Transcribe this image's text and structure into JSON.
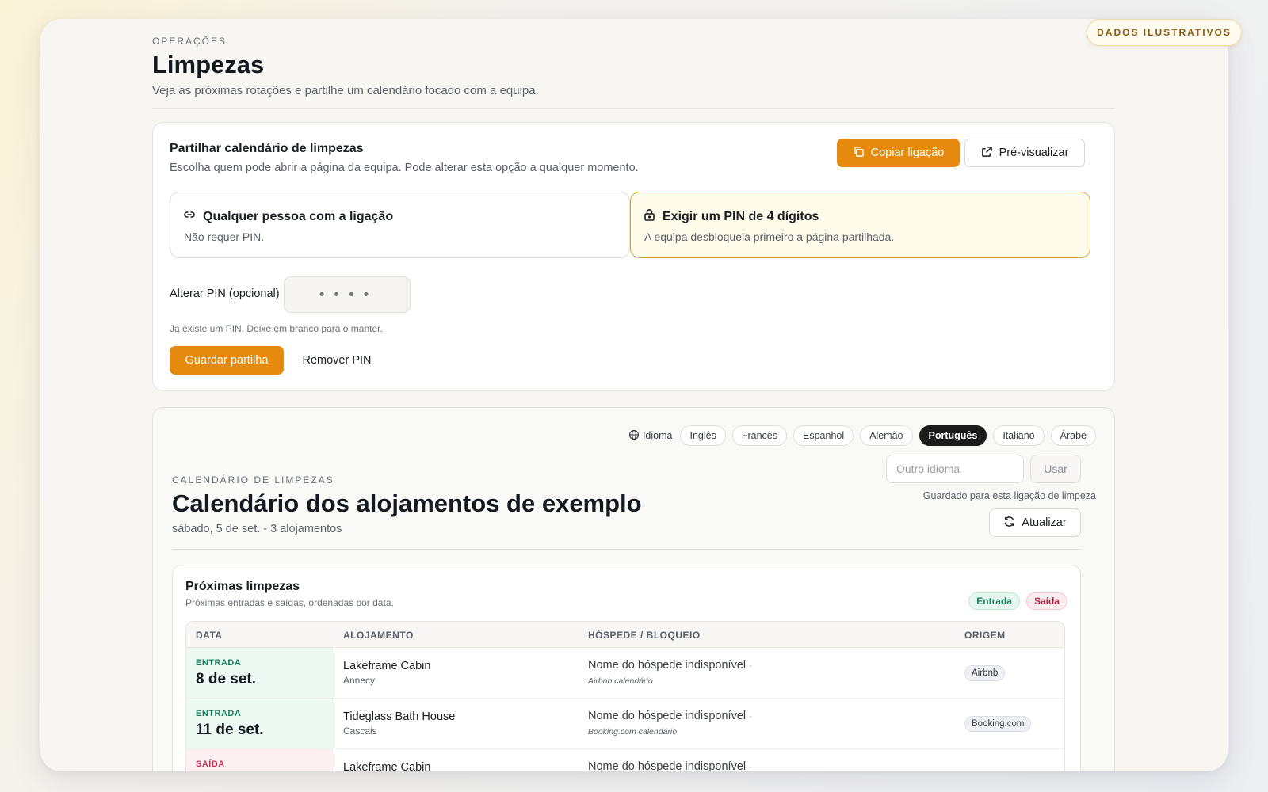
{
  "badge": "DADOS ILUSTRATIVOS",
  "header": {
    "eyebrow": "OPERAÇÕES",
    "title": "Limpezas",
    "subtitle": "Veja as próximas rotações e partilhe um calendário focado com a equipa."
  },
  "share": {
    "title": "Partilhar calendário de limpezas",
    "description": "Escolha quem pode abrir a página da equipa. Pode alterar esta opção a qualquer momento.",
    "copy_label": "Copiar ligação",
    "preview_label": "Pré-visualizar",
    "options": [
      {
        "title": "Qualquer pessoa com a ligação",
        "desc": "Não requer PIN.",
        "icon": "link-icon",
        "selected": false
      },
      {
        "title": "Exigir um PIN de 4 dígitos",
        "desc": "A equipa desbloqueia primeiro a página partilhada.",
        "icon": "lock-icon",
        "selected": true
      }
    ],
    "pin_label": "Alterar PIN (opcional)",
    "pin_placeholder": "••••",
    "pin_help": "Já existe um PIN. Deixe em branco para o manter.",
    "save_label": "Guardar partilha",
    "remove_label": "Remover PIN"
  },
  "calendar": {
    "language_label": "Idioma",
    "languages": [
      "Inglês",
      "Francês",
      "Espanhol",
      "Alemão",
      "Português",
      "Italiano",
      "Árabe"
    ],
    "selected_language": "Português",
    "other_placeholder": "Outro idioma",
    "use_label": "Usar",
    "saved_note": "Guardado para esta ligação de limpeza",
    "refresh_label": "Atualizar",
    "eyebrow": "CALENDÁRIO DE LIMPEZAS",
    "title": "Calendário dos alojamentos de exemplo",
    "subtitle": "sábado, 5 de set. - 3 alojamentos"
  },
  "upcoming": {
    "title": "Próximas limpezas",
    "description": "Próximas entradas e saídas, ordenadas por data.",
    "legend_in": "Entrada",
    "legend_out": "Saída",
    "columns": [
      "DATA",
      "ALOJAMENTO",
      "HÓSPEDE / BLOQUEIO",
      "ORIGEM"
    ],
    "rows": [
      {
        "kind": "ENTRADA",
        "date": "8 de set.",
        "property": "Lakeframe Cabin",
        "location": "Annecy",
        "guest": "Nome do hóspede indisponível",
        "dash": "-",
        "source": "Airbnb calendário",
        "origin": "Airbnb"
      },
      {
        "kind": "ENTRADA",
        "date": "11 de set.",
        "property": "Tideglass Bath House",
        "location": "Cascais",
        "guest": "Nome do hóspede indisponível",
        "dash": "-",
        "source": "Booking.com calendário",
        "origin": "Booking.com"
      },
      {
        "kind": "SAÍDA",
        "date": "",
        "property": "Lakeframe Cabin",
        "location": "",
        "guest": "Nome do hóspede indisponível",
        "dash": "-",
        "source": "",
        "origin": ""
      }
    ]
  },
  "colors": {
    "accent": "#e58a0f",
    "entry": "#16825a",
    "exit": "#c03255"
  }
}
